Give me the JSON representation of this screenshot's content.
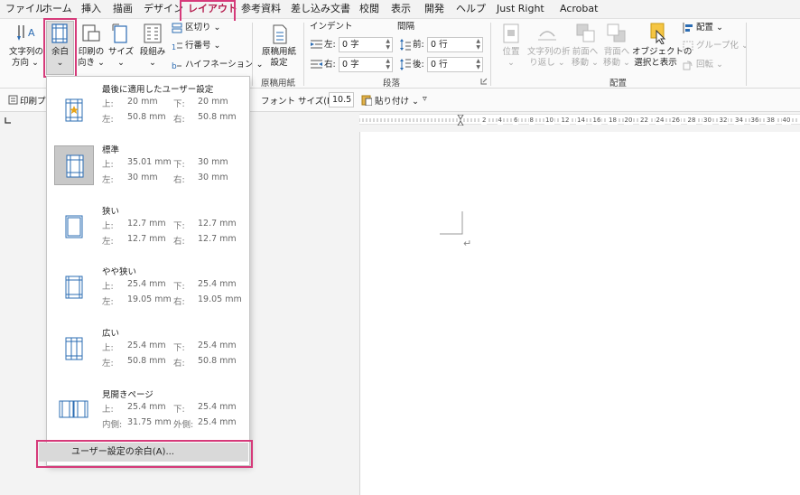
{
  "tabs": [
    "ファイル",
    "ホーム",
    "挿入",
    "描画",
    "デザイン",
    "レイアウト",
    "参考資料",
    "差し込み文書",
    "校閲",
    "表示",
    "開発",
    "ヘルプ",
    "Just Right",
    "Acrobat"
  ],
  "active_tab": "レイアウト",
  "ribbon": {
    "text_direction": [
      "文字列の",
      "方向 ⌄"
    ],
    "margins": [
      "余白",
      "⌄"
    ],
    "orientation": [
      "印刷の",
      "向き ⌄"
    ],
    "size": [
      "サイズ",
      "⌄"
    ],
    "columns": [
      "段組み",
      "⌄"
    ],
    "breaks": "区切り ⌄",
    "line_numbers": "行番号 ⌄",
    "hyphenation": "ハイフネーション ⌄",
    "manuscript": [
      "原稿用紙",
      "設定"
    ],
    "manuscript_group": "原稿用紙",
    "indent_header": "インデント",
    "spacing_header": "間隔",
    "indent_left_label": "左:",
    "indent_left_value": "0 字",
    "indent_right_label": "右:",
    "indent_right_value": "0 字",
    "spacing_before_label": "前:",
    "spacing_before_value": "0 行",
    "spacing_after_label": "後:",
    "spacing_after_value": "0 行",
    "paragraph_group": "段落",
    "position": [
      "位置",
      "⌄"
    ],
    "wrap_text": [
      "文字列の折",
      "り返し ⌄"
    ],
    "bring_forward": [
      "前面へ",
      "移動 ⌄"
    ],
    "send_backward": [
      "背面へ",
      "移動 ⌄"
    ],
    "selection_pane": [
      "オブジェクトの",
      "選択と表示"
    ],
    "align": "配置 ⌄",
    "group": "グループ化 ⌄",
    "rotate": "回転 ⌄",
    "arrange_group": "配置"
  },
  "toolbar": {
    "print_preview": "印刷プレ",
    "font_size_label": "フォント サイズ(F):",
    "font_size_value": "10.5",
    "paste": "貼り付け ⌄",
    "more": "▿"
  },
  "ruler_numbers": [
    "2",
    "4",
    "6",
    "8",
    "10",
    "12",
    "14",
    "16",
    "18",
    "20",
    "22",
    "24",
    "26",
    "28",
    "30",
    "32",
    "34",
    "36",
    "38",
    "40"
  ],
  "margin_options": [
    {
      "title": "最後に適用したユーザー設定",
      "k1": "上:",
      "v1": "20 mm",
      "k2": "下:",
      "v2": "20 mm",
      "k3": "左:",
      "v3": "50.8 mm",
      "k4": "右:",
      "v4": "50.8 mm"
    },
    {
      "title": "標準",
      "k1": "上:",
      "v1": "35.01 mm",
      "k2": "下:",
      "v2": "30 mm",
      "k3": "左:",
      "v3": "30 mm",
      "k4": "右:",
      "v4": "30 mm"
    },
    {
      "title": "狭い",
      "k1": "上:",
      "v1": "12.7 mm",
      "k2": "下:",
      "v2": "12.7 mm",
      "k3": "左:",
      "v3": "12.7 mm",
      "k4": "右:",
      "v4": "12.7 mm"
    },
    {
      "title": "やや狭い",
      "k1": "上:",
      "v1": "25.4 mm",
      "k2": "下:",
      "v2": "25.4 mm",
      "k3": "左:",
      "v3": "19.05 mm",
      "k4": "右:",
      "v4": "19.05 mm"
    },
    {
      "title": "広い",
      "k1": "上:",
      "v1": "25.4 mm",
      "k2": "下:",
      "v2": "25.4 mm",
      "k3": "左:",
      "v3": "50.8 mm",
      "k4": "右:",
      "v4": "50.8 mm"
    },
    {
      "title": "見開きページ",
      "k1": "上:",
      "v1": "25.4 mm",
      "k2": "下:",
      "v2": "25.4 mm",
      "k3": "内側:",
      "v3": "31.75 mm",
      "k4": "外側:",
      "v4": "25.4 mm"
    }
  ],
  "custom_margins": "ユーザー設定の余白(A)...",
  "paragraph_mark": "↵",
  "colors": {
    "accent": "#b51e4f",
    "highlight": "#d63a7a",
    "icon_blue": "#2b6cb3",
    "star": "#e8a317"
  }
}
